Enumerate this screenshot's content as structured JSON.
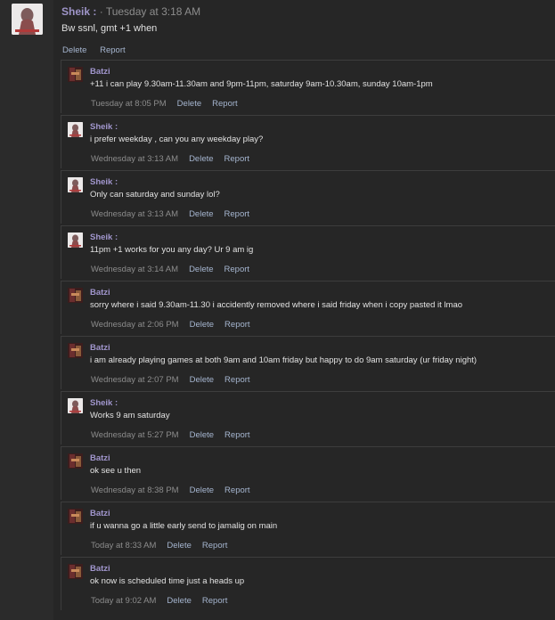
{
  "op": {
    "author": "Sheik :",
    "timestamp": "· Tuesday at 3:18 AM",
    "text": "Bw ssnl, gmt +1 when",
    "delete_label": "Delete",
    "report_label": "Report"
  },
  "replies": [
    {
      "author": "Batzi",
      "text": "+11 i can play 9.30am-11.30am and 9pm-11pm, saturday 9am-10.30am, sunday 10am-1pm",
      "time": "Tuesday at 8:05 PM",
      "delete": "Delete",
      "report": "Report"
    },
    {
      "author": "Sheik :",
      "text": "i prefer weekday , can you any weekday play?",
      "time": "Wednesday at 3:13 AM",
      "delete": "Delete",
      "report": "Report"
    },
    {
      "author": "Sheik :",
      "text": "Only can saturday and sunday lol?",
      "time": "Wednesday at 3:13 AM",
      "delete": "Delete",
      "report": "Report"
    },
    {
      "author": "Sheik :",
      "text": "11pm +1 works for you any day? Ur 9 am ig",
      "time": "Wednesday at 3:14 AM",
      "delete": "Delete",
      "report": "Report"
    },
    {
      "author": "Batzi",
      "text": "sorry where i said 9.30am-11.30 i accidently removed where i said friday when i copy pasted it lmao",
      "time": "Wednesday at 2:06 PM",
      "delete": "Delete",
      "report": "Report"
    },
    {
      "author": "Batzi",
      "text": "i am already playing games at both 9am and 10am friday but happy to do 9am saturday (ur friday night)",
      "time": "Wednesday at 2:07 PM",
      "delete": "Delete",
      "report": "Report"
    },
    {
      "author": "Sheik :",
      "text": "Works 9 am saturday",
      "time": "Wednesday at 5:27 PM",
      "delete": "Delete",
      "report": "Report"
    },
    {
      "author": "Batzi",
      "text": "ok see u then",
      "time": "Wednesday at 8:38 PM",
      "delete": "Delete",
      "report": "Report"
    },
    {
      "author": "Batzi",
      "text": "if u wanna go a little early send to jamalig on main",
      "time": "Today at 8:33 AM",
      "delete": "Delete",
      "report": "Report"
    },
    {
      "author": "Batzi",
      "text": "ok now is scheduled time just a heads up",
      "time": "Today at 9:02 AM",
      "delete": "Delete",
      "report": "Report"
    }
  ],
  "colors": {
    "background": "#262626",
    "author": "#a196cd",
    "action": "#a5b5cf",
    "timestamp": "#8c8c8c"
  }
}
